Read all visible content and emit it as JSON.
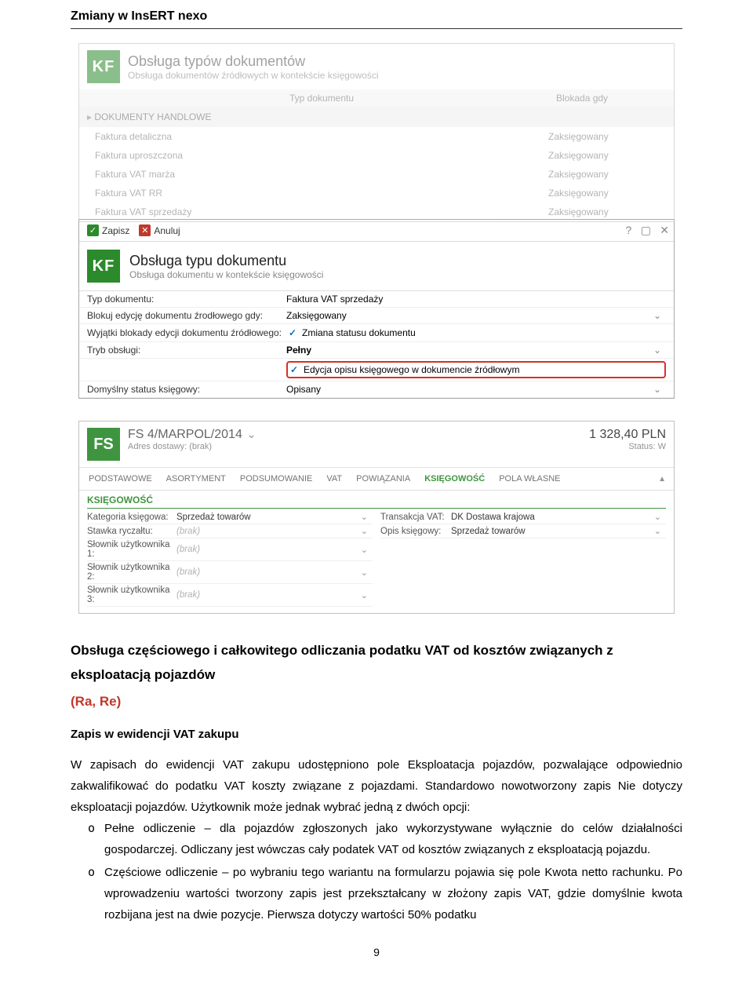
{
  "header": "Zmiany w InsERT nexo",
  "kf_list": {
    "badge": "KF",
    "title": "Obsługa typów dokumentów",
    "subtitle": "Obsługa dokumentów źródłowych w kontekście księgowości",
    "col_doc": "Typ dokumentu",
    "col_block": "Blokada gdy",
    "group": "DOKUMENTY HANDLOWE",
    "rows": [
      {
        "doc": "Faktura detaliczna",
        "block": "Zaksięgowany"
      },
      {
        "doc": "Faktura uproszczona",
        "block": "Zaksięgowany"
      },
      {
        "doc": "Faktura VAT marża",
        "block": "Zaksięgowany"
      },
      {
        "doc": "Faktura VAT RR",
        "block": "Zaksięgowany"
      },
      {
        "doc": "Faktura VAT sprzedaży",
        "block": "Zaksięgowany"
      }
    ]
  },
  "kf_form": {
    "save": "Zapisz",
    "cancel": "Anuluj",
    "badge": "KF",
    "title": "Obsługa typu dokumentu",
    "subtitle": "Obsługa dokumentu w kontekście księgowości",
    "rows": {
      "l_type": "Typ dokumentu:",
      "v_type": "Faktura VAT sprzedaży",
      "l_block": "Blokuj edycję dokumentu źrodłowego gdy:",
      "v_block": "Zaksięgowany",
      "l_exc": "Wyjątki blokady edycji dokumentu źródłowego:",
      "v_exc": "Zmiana statusu dokumentu",
      "l_mode": "Tryb obsługi:",
      "v_mode": "Pełny",
      "v_checkbox": "Edycja opisu księgowego w dokumencie źródłowym",
      "l_status": "Domyślny status księgowy:",
      "v_status": "Opisany"
    }
  },
  "fs": {
    "badge": "FS",
    "title": "FS 4/MARPOL/2014",
    "addr_label": "Adres dostawy:",
    "addr_val": "(brak)",
    "amount": "1 328,40 PLN",
    "status": "Status: W",
    "tabs": [
      "PODSTAWOWE",
      "ASORTYMENT",
      "PODSUMOWANIE",
      "VAT",
      "POWIĄZANIA",
      "KSIĘGOWOŚĆ",
      "POLA WŁASNE"
    ],
    "section": "KSIĘGOWOŚĆ",
    "left": {
      "l_cat": "Kategoria księgowa:",
      "v_cat": "Sprzedaż towarów",
      "l_rate": "Stawka ryczałtu:",
      "v_rate": "(brak)",
      "l_s1": "Słownik użytkownika 1:",
      "v_s1": "(brak)",
      "l_s2": "Słownik użytkownika 2:",
      "v_s2": "(brak)",
      "l_s3": "Słownik użytkownika 3:",
      "v_s3": "(brak)"
    },
    "right": {
      "l_tvat": "Transakcja VAT:",
      "v_tvat": "DK   Dostawa krajowa",
      "l_opis": "Opis księgowy:",
      "v_opis": "Sprzedaż towarów"
    }
  },
  "body": {
    "title_black": "Obsługa częściowego i całkowitego odliczania podatku VAT od kosztów związanych z eksploatacją pojazdów",
    "title_red": "(Ra, Re)",
    "subhead": "Zapis w ewidencji VAT zakupu",
    "p1": "W zapisach do ewidencji VAT zakupu udostępniono pole Eksploatacja pojazdów, pozwalające odpowiednio zakwalifikować do podatku VAT koszty związane z pojazdami. Standardowo nowotworzony zapis Nie dotyczy eksploatacji pojazdów. Użytkownik może jednak wybrać jedną z dwóch opcji:",
    "b1": "Pełne odliczenie – dla pojazdów zgłoszonych jako wykorzystywane wyłącznie do celów działalności gospodarczej. Odliczany jest wówczas cały podatek VAT od kosztów związanych z eksploatacją pojazdu.",
    "b2": "Częściowe odliczenie – po wybraniu tego wariantu na formularzu pojawia się pole Kwota netto rachunku. Po wprowadzeniu wartości tworzony zapis jest przekształcany w złożony zapis VAT, gdzie domyślnie kwota rozbijana jest na dwie pozycje. Pierwsza dotyczy wartości 50% podatku"
  },
  "page_num": "9"
}
